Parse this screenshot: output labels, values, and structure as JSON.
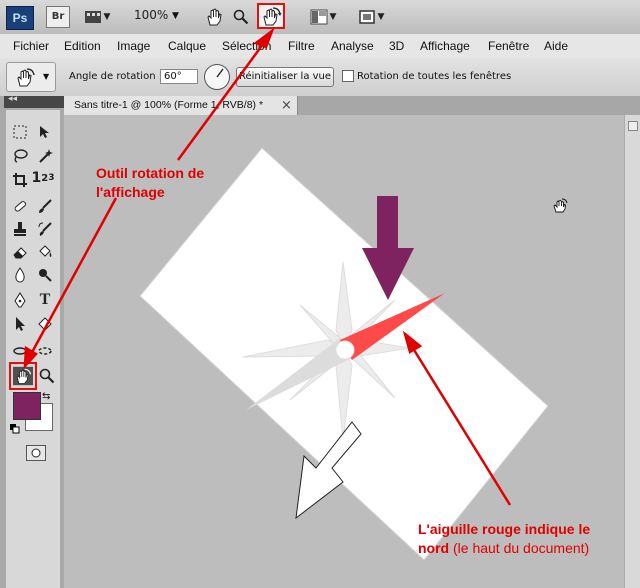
{
  "appbar": {
    "logo": "Ps",
    "bridge": "Br",
    "zoom": "100%",
    "icons": [
      "film-strip-icon",
      "hand-icon",
      "zoom-icon",
      "rotate-view-icon",
      "arrange-docs-icon",
      "screen-mode-icon"
    ]
  },
  "menu": {
    "items": [
      "Fichier",
      "Edition",
      "Image",
      "Calque",
      "Sélection",
      "Filtre",
      "Analyse",
      "3D",
      "Affichage",
      "Fenêtre",
      "Aide"
    ]
  },
  "options": {
    "angle_label": "Angle de rotation :",
    "angle_value": "60°",
    "reset_label": "Réinitialiser la vue",
    "rotate_all_label": "Rotation de toutes les fenêtres"
  },
  "tab": {
    "title": "Sans titre-1 @ 100% (Forme 1, RVB/8) *",
    "close": "×"
  },
  "toolbox": {
    "collapse": "◂◂",
    "fg_color": "#7e2360",
    "bg_color": "#ffffff"
  },
  "annotations": {
    "tool_line1": "Outil rotation de",
    "tool_line2": "l'affichage",
    "needle_line1": "L'aiguille rouge indique le",
    "needle_bold": "nord",
    "needle_rest": " (le haut du document)"
  },
  "colors": {
    "annotation": "#e00000",
    "needle": "#ff3b3b",
    "arrow": "#7e2360"
  }
}
